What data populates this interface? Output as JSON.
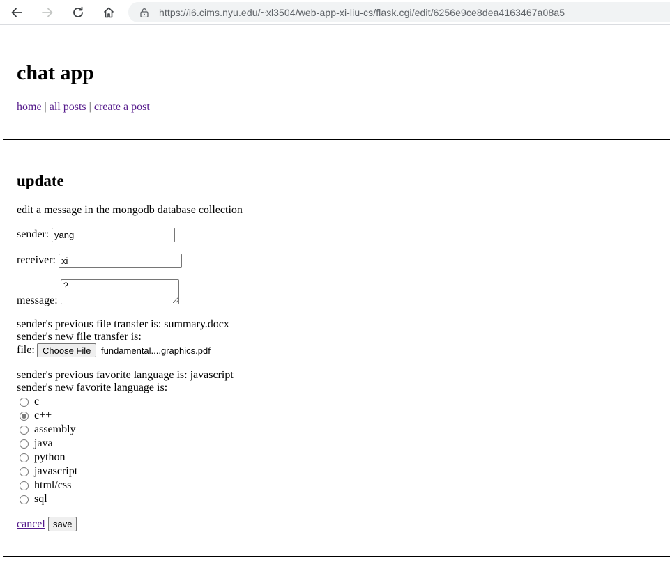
{
  "browser": {
    "url": "https://i6.cims.nyu.edu/~xl3504/web-app-xi-liu-cs/flask.cgi/edit/6256e9ce8dea4163467a08a5",
    "icons": [
      "back-arrow-icon",
      "forward-arrow-icon",
      "reload-icon",
      "home-icon",
      "lock-icon"
    ]
  },
  "site": {
    "title": "chat app",
    "nav": [
      {
        "label": "home"
      },
      {
        "label": "all posts"
      },
      {
        "label": "create a post"
      }
    ],
    "separator": "|"
  },
  "form": {
    "heading": "update",
    "description": "edit a message in the mongodb database collection",
    "sender_label": "sender:",
    "sender_value": "yang",
    "receiver_label": "receiver:",
    "receiver_value": "xi",
    "message_label": "message:",
    "message_value": "?",
    "previous_file_text": "sender's previous file transfer is: summary.docx",
    "new_file_text": "sender's new file transfer is:",
    "file_label": "file:",
    "choose_file_label": "Choose File",
    "chosen_file_name": "fundamental....graphics.pdf",
    "previous_language_text": "sender's previous favorite language is: javascript",
    "new_language_text": "sender's new favorite language is:",
    "languages": [
      {
        "label": "c",
        "checked": false
      },
      {
        "label": "c++",
        "checked": true
      },
      {
        "label": "assembly",
        "checked": false
      },
      {
        "label": "java",
        "checked": false
      },
      {
        "label": "python",
        "checked": false
      },
      {
        "label": "javascript",
        "checked": false
      },
      {
        "label": "html/css",
        "checked": false
      },
      {
        "label": "sql",
        "checked": false
      }
    ],
    "cancel_label": "cancel",
    "save_label": "save"
  }
}
